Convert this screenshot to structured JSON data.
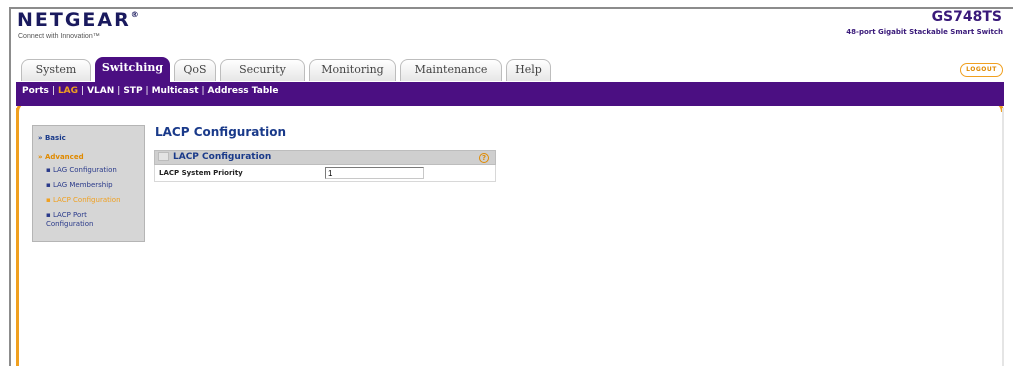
{
  "header": {
    "brand": "NETGEAR",
    "brand_mark": "®",
    "tagline": "Connect with Innovation™",
    "model": "GS748TS",
    "model_description": "48-port Gigabit Stackable Smart Switch",
    "logout_label": "LOGOUT"
  },
  "tabs": [
    {
      "label": "System",
      "active": false
    },
    {
      "label": "Switching",
      "active": true
    },
    {
      "label": "QoS",
      "active": false
    },
    {
      "label": "Security",
      "active": false
    },
    {
      "label": "Monitoring",
      "active": false
    },
    {
      "label": "Maintenance",
      "active": false
    },
    {
      "label": "Help",
      "active": false
    }
  ],
  "subnav": [
    {
      "label": "Ports",
      "active": false
    },
    {
      "label": "LAG",
      "active": true
    },
    {
      "label": "VLAN",
      "active": false
    },
    {
      "label": "STP",
      "active": false
    },
    {
      "label": "Multicast",
      "active": false
    },
    {
      "label": "Address Table",
      "active": false
    }
  ],
  "sidemenu": {
    "basic": "Basic",
    "advanced": "Advanced",
    "items": [
      {
        "label": "LAG Configuration",
        "active": false
      },
      {
        "label": "LAG Membership",
        "active": false
      },
      {
        "label": "LACP Configuration",
        "active": true
      },
      {
        "label": "LACP Port Configuration",
        "active": false
      }
    ]
  },
  "main": {
    "title": "LACP Configuration",
    "panel_title": "LACP Configuration",
    "field_label": "LACP System Priority",
    "field_value": "1"
  },
  "colors": {
    "brand_purple": "#4b0f82",
    "accent_orange": "#f0a020",
    "link_blue": "#1a3a8a"
  },
  "icons": {
    "help": "help-icon"
  }
}
